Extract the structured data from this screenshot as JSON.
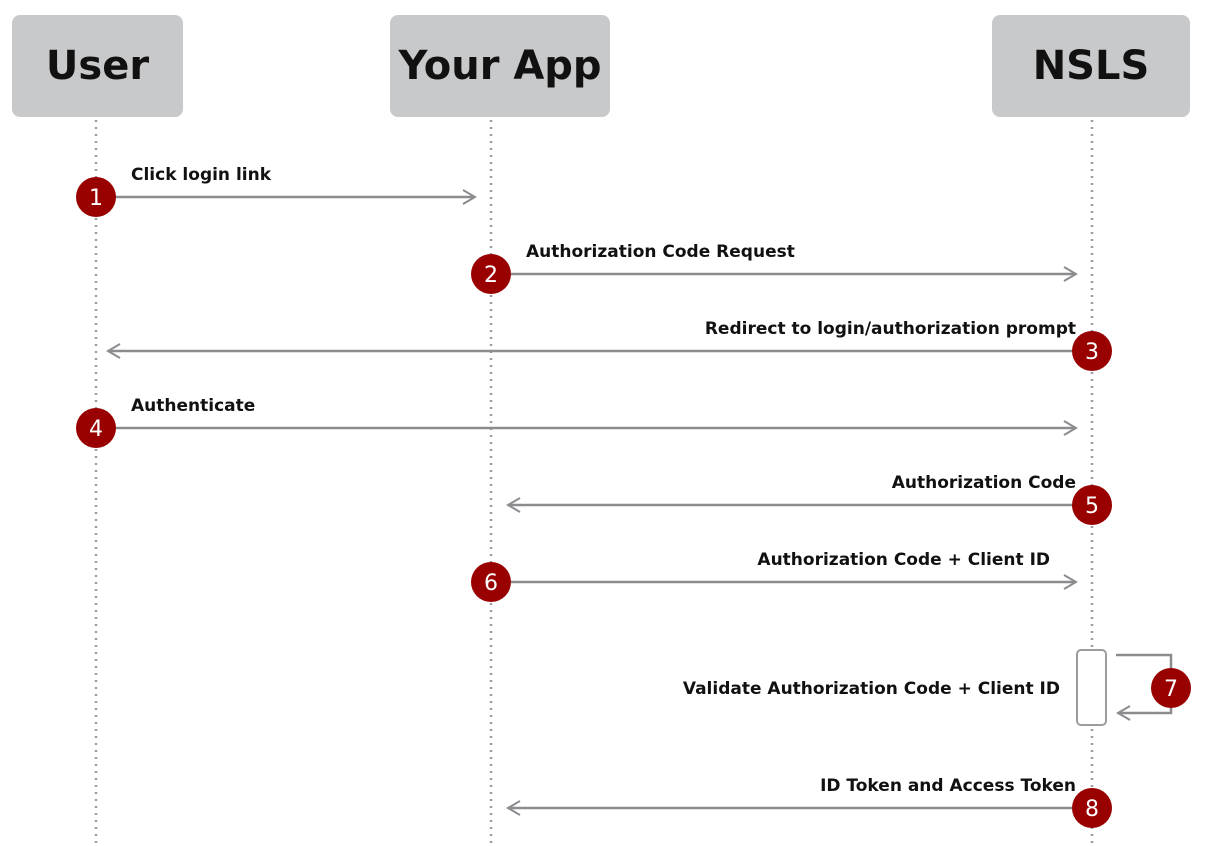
{
  "actors": [
    {
      "name": "User"
    },
    {
      "name": "Your App"
    },
    {
      "name": "NSLS"
    }
  ],
  "messages": [
    {
      "step": "1",
      "label": "Click login link",
      "from": "User",
      "to": "Your App"
    },
    {
      "step": "2",
      "label": "Authorization Code Request",
      "from": "Your App",
      "to": "NSLS"
    },
    {
      "step": "3",
      "label": "Redirect to login/authorization prompt",
      "from": "NSLS",
      "to": "User"
    },
    {
      "step": "4",
      "label": "Authenticate",
      "from": "User",
      "to": "NSLS"
    },
    {
      "step": "5",
      "label": "Authorization Code",
      "from": "NSLS",
      "to": "Your App"
    },
    {
      "step": "6",
      "label": "Authorization Code + Client ID",
      "from": "Your App",
      "to": "NSLS"
    },
    {
      "step": "7",
      "label": "Validate Authorization Code + Client ID",
      "from": "NSLS",
      "to": "NSLS"
    },
    {
      "step": "8",
      "label": "ID Token and Access Token",
      "from": "NSLS",
      "to": "Your App"
    }
  ],
  "colors": {
    "badge": "#990000",
    "arrow": "#8a8c8f",
    "actor_bg": "#c8c9cb"
  }
}
